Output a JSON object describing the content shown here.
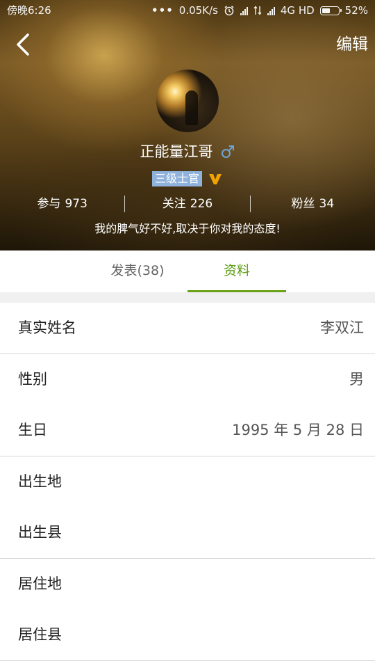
{
  "status_bar": {
    "time": "傍晚6:26",
    "dots": "•••",
    "speed": "0.05K/s",
    "network": "4G HD",
    "battery_text": "52%",
    "battery_level": 0.52
  },
  "nav": {
    "back_icon": "chevron-left-icon",
    "edit_label": "编辑"
  },
  "profile": {
    "name": "正能量江哥",
    "gender_icon": "male-icon",
    "gender_color": "#6fa4d6",
    "rank": "三级士官",
    "vip_icon": "vip-v-icon",
    "vip_color": "#f2a300",
    "stats": [
      {
        "label": "参与",
        "value": "973"
      },
      {
        "label": "关注",
        "value": "226"
      },
      {
        "label": "粉丝",
        "value": "34"
      }
    ],
    "signature": "我的脾气好不好,取决于你对我的态度!"
  },
  "tabs": [
    {
      "label": "发表(38)",
      "active": false
    },
    {
      "label": "资料",
      "active": true
    }
  ],
  "accent_color": "#6aa319",
  "info": {
    "real_name": {
      "label": "真实姓名",
      "value": "李双江"
    },
    "gender": {
      "label": "性别",
      "value": "男"
    },
    "birthday": {
      "label": "生日",
      "value": "1995 年 5 月 28 日"
    },
    "birthplace": {
      "label": "出生地",
      "value": ""
    },
    "birth_county": {
      "label": "出生县",
      "value": ""
    },
    "residence": {
      "label": "居住地",
      "value": ""
    },
    "residence_county": {
      "label": "居住县",
      "value": ""
    }
  }
}
